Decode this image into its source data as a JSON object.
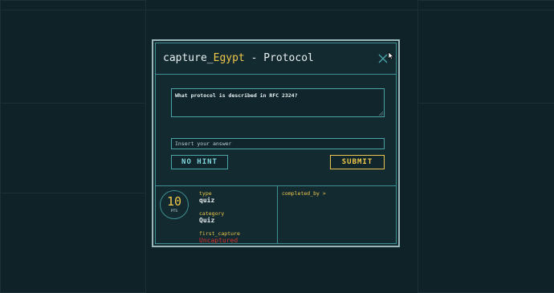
{
  "modal": {
    "title_prefix": "capture_",
    "title_accent": "Egypt",
    "title_suffix": " - Protocol",
    "question": "What protocol is described in RFC 2324?",
    "answer_placeholder": "Insert your answer",
    "answer_value": "",
    "hint_label": "NO HINT",
    "submit_label": "SUBMIT",
    "points": "10",
    "points_unit": "PTS",
    "type_label": "type",
    "type_value": "quiz",
    "category_label": "category",
    "category_value": "Quiz",
    "first_capture_label": "first_capture",
    "first_capture_value": "Uncaptured",
    "completed_by_label": "completed_by >"
  },
  "colors": {
    "accent": "#f0c84b",
    "border": "#3f8f93",
    "hint": "#7fd6da",
    "uncaptured": "#d8332f",
    "background": "#0f2228"
  },
  "icons": [
    "close-icon",
    "mouse-cursor-icon",
    "resize-grip-icon"
  ]
}
